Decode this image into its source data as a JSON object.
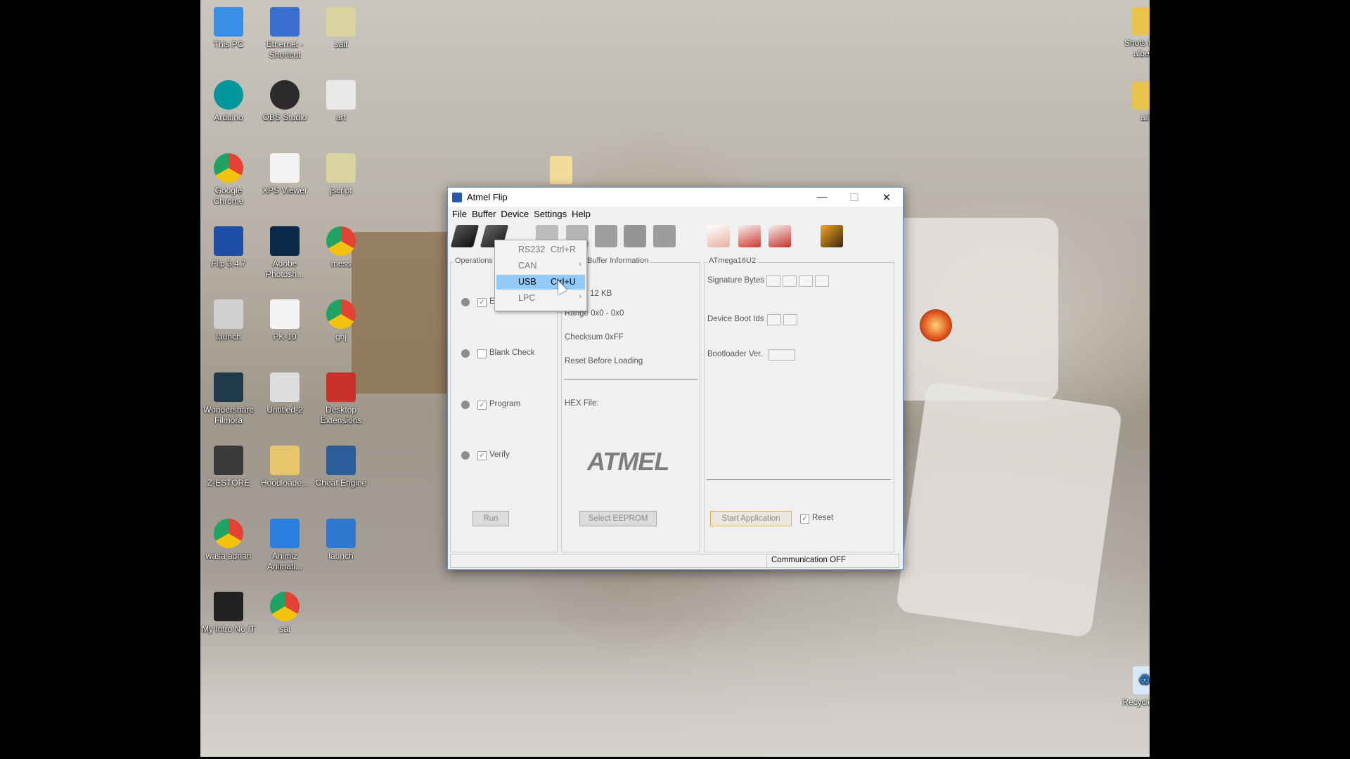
{
  "desktop": {
    "icons": [
      {
        "label": "This PC",
        "icon": "monitor-icon",
        "color": "#3a8ee6"
      },
      {
        "label": "Ethernet - Shortcut",
        "icon": "network-icon",
        "color": "#3a6fd0"
      },
      {
        "label": "saif",
        "icon": "script-icon",
        "color": "#d9d3a0"
      },
      {
        "label": "Arduino",
        "icon": "arduino-icon",
        "color": "#00979c"
      },
      {
        "label": "OBS Studio",
        "icon": "obs-icon",
        "color": "#2b2b2b"
      },
      {
        "label": "art",
        "icon": "image-file-icon",
        "color": "#e8e8e8"
      },
      {
        "label": "Google Chrome",
        "icon": "chrome-icon",
        "color": "#e34133"
      },
      {
        "label": "XPS Viewer",
        "icon": "book-icon",
        "color": "#f2f2f2"
      },
      {
        "label": "jscript",
        "icon": "script-icon",
        "color": "#d9d3a0"
      },
      {
        "label": "Flip 3.4.7",
        "icon": "flip-icon",
        "color": "#1f4ea8"
      },
      {
        "label": "Adobe Photosh...",
        "icon": "photoshop-icon",
        "color": "#0b2a4a"
      },
      {
        "label": "mess",
        "icon": "chrome-icon",
        "color": "#e34133"
      },
      {
        "label": "launch",
        "icon": "settings-file-icon",
        "color": "#d0d0d0"
      },
      {
        "label": "PK-10",
        "icon": "blank-file-icon",
        "color": "#f4f4f4"
      },
      {
        "label": "ghj",
        "icon": "chrome-icon",
        "color": "#e34133"
      },
      {
        "label": "Wondershare Filmora",
        "icon": "filmora-icon",
        "color": "#1f3a4a"
      },
      {
        "label": "Untitled-2",
        "icon": "image-file-icon",
        "color": "#dcdcdc"
      },
      {
        "label": "Desktop Extensions",
        "icon": "book-red-icon",
        "color": "#c8322a"
      },
      {
        "label": "Z-ESTORE",
        "icon": "image-file-icon",
        "color": "#3a3a3a"
      },
      {
        "label": "Hoodloade...",
        "icon": "folder-zip-icon",
        "color": "#e6c56b"
      },
      {
        "label": "Cheat Engine",
        "icon": "cheat-engine-icon",
        "color": "#2a5d9a"
      },
      {
        "label": "wasa adnan",
        "icon": "chrome-icon",
        "color": "#e34133"
      },
      {
        "label": "Animiz Animati...",
        "icon": "animiz-icon",
        "color": "#2b7de0"
      },
      {
        "label": "launch",
        "icon": "window-file-icon",
        "color": "#2f7ad0"
      },
      {
        "label": "My Intro No IT",
        "icon": "video-file-icon",
        "color": "#222222"
      },
      {
        "label": "sai",
        "icon": "chrome-icon",
        "color": "#e34133"
      }
    ],
    "right_icons": [
      {
        "label": "Shots from albela",
        "icon": "folder-icon",
        "color": "#e9c34b"
      },
      {
        "label": "ali",
        "icon": "folder-zip-icon",
        "color": "#e9c34b"
      },
      {
        "label": "Recycle Bin",
        "icon": "recycle-bin-icon",
        "color": "#cfe3f4"
      }
    ]
  },
  "window": {
    "title": "Atmel Flip",
    "minimize": "—",
    "maximize": "☐",
    "close": "✕",
    "menu": [
      "File",
      "Buffer",
      "Device",
      "Settings",
      "Help"
    ],
    "toolbar": [
      "select-device-icon",
      "communication-icon",
      "erase-icon",
      "blank-check-icon",
      "program-icon",
      "verify-icon",
      "read-icon",
      "load-hex-icon",
      "save-buffer-icon",
      "edit-buffer-icon",
      "help-book-icon"
    ],
    "operations": {
      "title": "Operations",
      "items": [
        {
          "label": "E",
          "checked": true
        },
        {
          "label": "Blank Check",
          "checked": false
        },
        {
          "label": "Program",
          "checked": true
        },
        {
          "label": "Verify",
          "checked": true
        }
      ],
      "run": "Run"
    },
    "buffer": {
      "title": "Buffer Information",
      "size": "12 KB",
      "range": "Range 0x0 - 0x0",
      "checksum": "Checksum 0xFF",
      "reset": "Reset Before Loading",
      "hex_file": "HEX File:",
      "logo": "ATMEL",
      "select_eeprom": "Select EEPROM"
    },
    "device": {
      "title": "ATmega16U2",
      "signature": "Signature Bytes",
      "boot_ids": "Device Boot Ids",
      "bootloader": "Bootloader Ver.",
      "start_app": "Start Application",
      "reset": "Reset",
      "reset_checked": true
    },
    "status": "Communication OFF"
  },
  "dropdown": {
    "items": [
      {
        "label": "RS232",
        "shortcut": "Ctrl+R",
        "submenu": false,
        "selected": false
      },
      {
        "label": "CAN",
        "shortcut": "",
        "submenu": true,
        "selected": false
      },
      {
        "label": "USB",
        "shortcut": "Ctrl+U",
        "submenu": false,
        "selected": true
      },
      {
        "label": "LPC",
        "shortcut": "",
        "submenu": true,
        "selected": false
      }
    ]
  }
}
